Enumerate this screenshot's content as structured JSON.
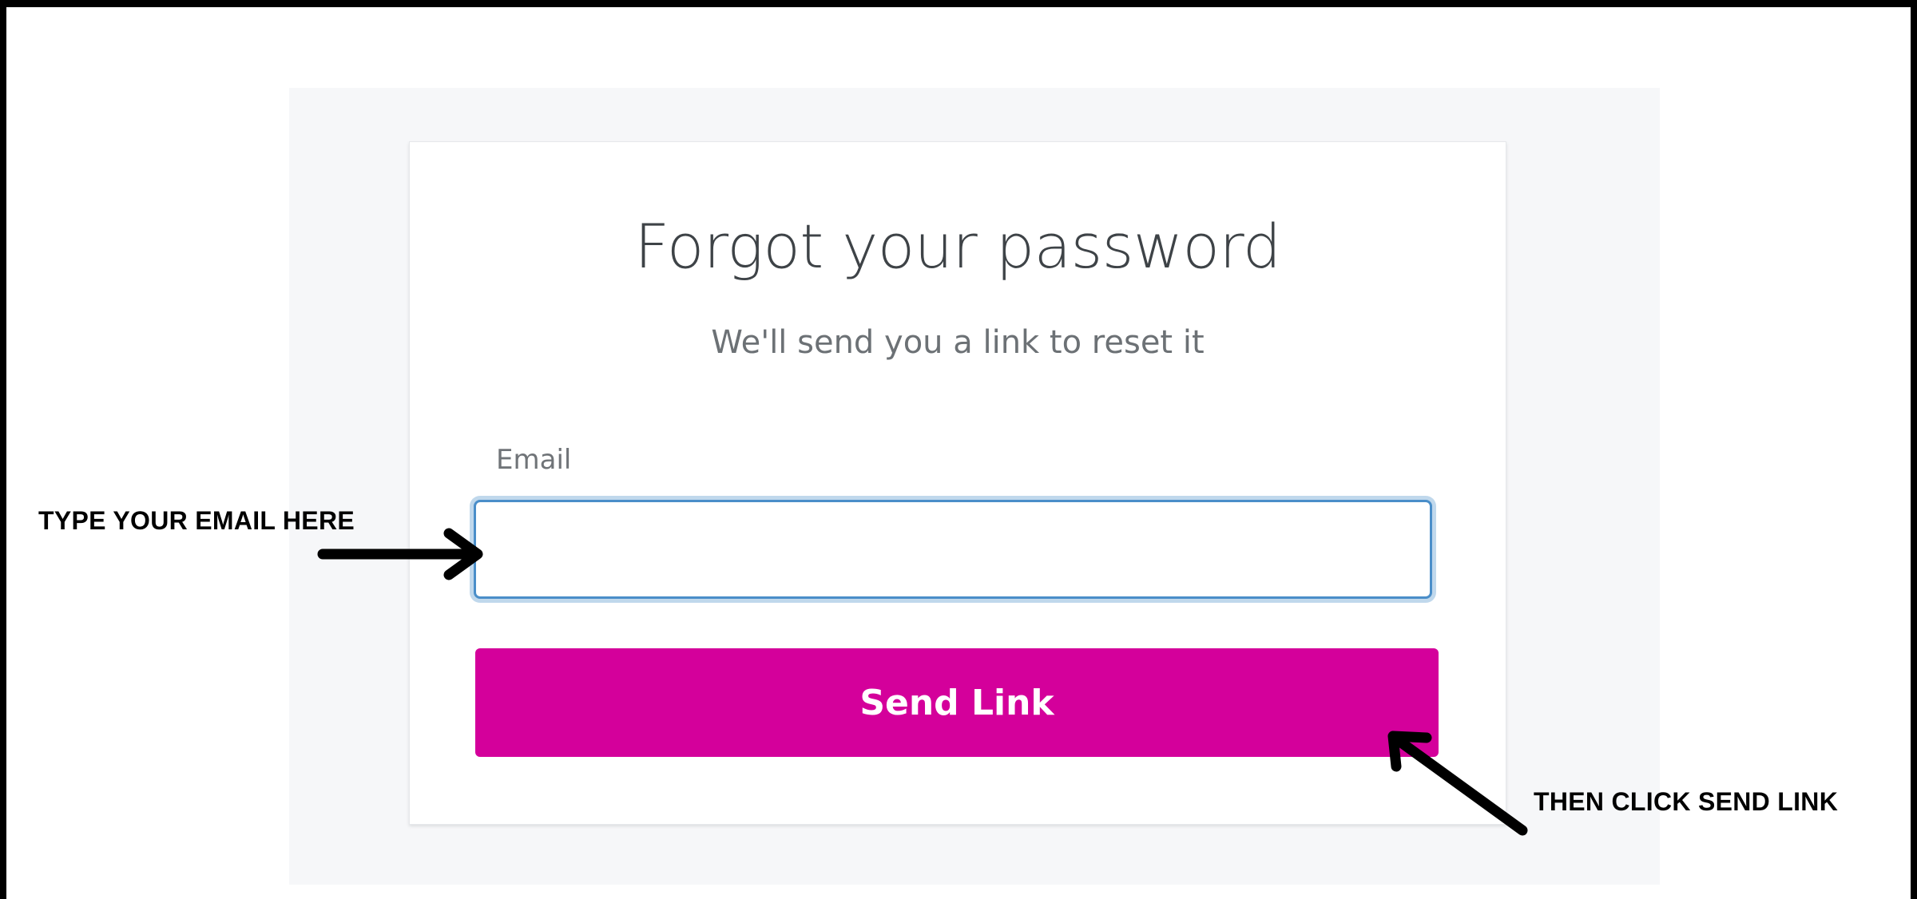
{
  "card": {
    "title": "Forgot your password",
    "subtitle": "We'll send you a link to reset it",
    "email_label": "Email",
    "email_value": "",
    "email_placeholder": "",
    "send_button_label": "Send Link"
  },
  "annotations": {
    "left_text": "TYPE YOUR EMAIL HERE",
    "right_text": "THEN CLICK SEND LINK"
  },
  "colors": {
    "accent_button": "#d4009b",
    "input_focus_border": "#4a8ec9",
    "panel_background": "#f6f7f9",
    "frame": "#000000"
  },
  "icons": {
    "left_arrow": "arrow-right-icon",
    "right_arrow": "arrow-up-left-icon"
  }
}
